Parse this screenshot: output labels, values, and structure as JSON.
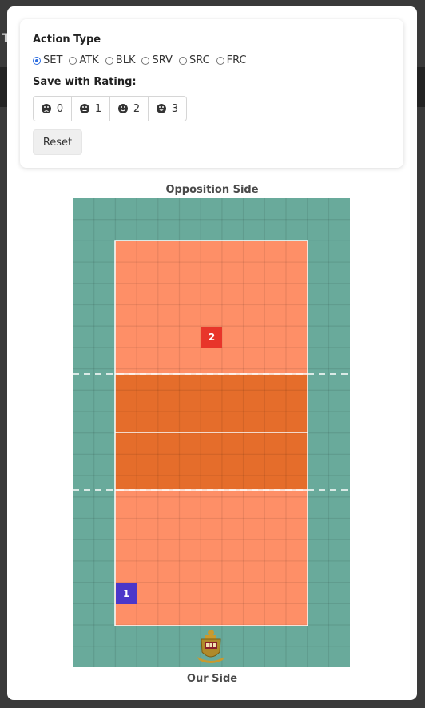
{
  "background": {
    "title_initial": "T"
  },
  "action": {
    "title": "Action Type",
    "options": [
      "SET",
      "ATK",
      "BLK",
      "SRV",
      "SRC",
      "FRC"
    ],
    "selected": "SET"
  },
  "rating": {
    "title": "Save with Rating:",
    "options": [
      {
        "value": "0",
        "icon": "frown-icon"
      },
      {
        "value": "1",
        "icon": "neutral-face-icon"
      },
      {
        "value": "2",
        "icon": "smile-icon"
      },
      {
        "value": "3",
        "icon": "grin-icon"
      }
    ]
  },
  "reset_label": "Reset",
  "court": {
    "top_label": "Opposition Side",
    "bottom_label": "Our Side",
    "colors": {
      "outer": "#69aa9b",
      "in_court": "#fe8f67",
      "front_zone": "#e56d2b",
      "line": "#ffffff",
      "grid": "#5d9b8d"
    },
    "players": [
      {
        "number": "2",
        "team": "opposition",
        "color": "#e8352a"
      },
      {
        "number": "1",
        "team": "our",
        "color": "#4b37c9"
      }
    ]
  }
}
